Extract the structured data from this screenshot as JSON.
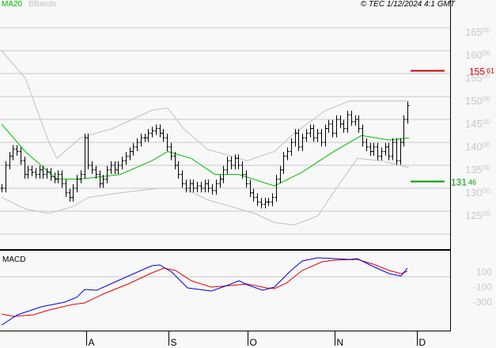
{
  "header": {
    "legend_ma": "MA20",
    "legend_bb": "BBands",
    "copyright": "© TEC 1/12/2024 4:1 GMT"
  },
  "colors": {
    "ma": "#00bb00",
    "bb": "#c0c0c0",
    "macd": "#0000dd",
    "signal": "#dd0000",
    "resistance": "#cc0000",
    "support": "#009900",
    "axis_text": "#c8c8c8"
  },
  "chart_data": [
    {
      "type": "line",
      "title": "Price",
      "ylim": [
        12000,
        16900
      ],
      "y_ticks": [
        12500,
        13000,
        13500,
        14000,
        14500,
        15000,
        15500,
        16000,
        16500
      ],
      "y_tick_labels": [
        "125",
        "130",
        "135",
        "140",
        "145",
        "150",
        "155",
        "160",
        "165"
      ],
      "y_tick_suffix": "00",
      "x_months": [
        {
          "label": "A",
          "day": 22.5
        },
        {
          "label": "S",
          "day": 44.4
        },
        {
          "label": "O",
          "day": 65.5
        },
        {
          "label": "N",
          "day": 88.6
        },
        {
          "label": "D",
          "day": 110.5
        }
      ],
      "close": [
        13000,
        13500,
        13700,
        13850,
        13800,
        13600,
        13300,
        13400,
        13350,
        13300,
        13400,
        13300,
        13350,
        13250,
        13200,
        13300,
        13100,
        12900,
        12800,
        13000,
        13200,
        13300,
        14100,
        13500,
        13400,
        13300,
        13100,
        13200,
        13400,
        13500,
        13400,
        13500,
        13600,
        13700,
        13800,
        13900,
        14000,
        14100,
        14100,
        14200,
        14250,
        14300,
        14200,
        14100,
        13900,
        13700,
        13500,
        13300,
        13100,
        13000,
        13100,
        13000,
        13050,
        13000,
        13100,
        13000,
        12950,
        13100,
        13200,
        13400,
        13600,
        13500,
        13650,
        13500,
        13300,
        13100,
        12900,
        12800,
        12700,
        12650,
        12700,
        12700,
        12800,
        13200,
        13400,
        13700,
        13800,
        14000,
        14200,
        13900,
        14100,
        14200,
        14300,
        14100,
        14200,
        14000,
        14300,
        14400,
        14200,
        14500,
        14400,
        14300,
        14600,
        14450,
        14500,
        14300,
        14000,
        13900,
        13800,
        13900,
        13700,
        13800,
        13900,
        13700,
        14000,
        13600,
        14000,
        14500,
        14800
      ],
      "ma20": [
        [
          0,
          14400
        ],
        [
          6.3,
          13800
        ],
        [
          14.7,
          13200
        ],
        [
          21,
          13200
        ],
        [
          31.6,
          13300
        ],
        [
          40,
          13600
        ],
        [
          44.2,
          13800
        ],
        [
          50.5,
          13650
        ],
        [
          56.8,
          13300
        ],
        [
          63.2,
          13300
        ],
        [
          72.6,
          13050
        ],
        [
          80,
          13350
        ],
        [
          88.4,
          13800
        ],
        [
          95.8,
          14150
        ],
        [
          103.2,
          14050
        ],
        [
          108.4,
          14100
        ]
      ],
      "bb_upper": [
        [
          0,
          16000
        ],
        [
          6.3,
          15400
        ],
        [
          12.6,
          14000
        ],
        [
          14.7,
          13650
        ],
        [
          21,
          14100
        ],
        [
          29.5,
          14300
        ],
        [
          40,
          14700
        ],
        [
          44.2,
          14750
        ],
        [
          48.4,
          14300
        ],
        [
          54.7,
          13850
        ],
        [
          61.1,
          13700
        ],
        [
          65.3,
          13600
        ],
        [
          72.6,
          13800
        ],
        [
          77.9,
          14200
        ],
        [
          86.3,
          14700
        ],
        [
          92.6,
          14900
        ],
        [
          98.9,
          14900
        ],
        [
          108.4,
          14900
        ]
      ],
      "bb_lower": [
        [
          0,
          12800
        ],
        [
          6.3,
          12550
        ],
        [
          12.6,
          12450
        ],
        [
          18.9,
          12600
        ],
        [
          23.2,
          12800
        ],
        [
          31.6,
          12900
        ],
        [
          42.1,
          13000
        ],
        [
          48.4,
          13000
        ],
        [
          54.7,
          12750
        ],
        [
          61.1,
          12600
        ],
        [
          67.4,
          12450
        ],
        [
          72.6,
          12250
        ],
        [
          77.9,
          12200
        ],
        [
          84.2,
          12400
        ],
        [
          89.5,
          13050
        ],
        [
          94.7,
          13650
        ],
        [
          101,
          13600
        ],
        [
          108.4,
          13450
        ]
      ],
      "resistance": {
        "value": 15561,
        "label_main": "155",
        "label_dec": "61"
      },
      "support": {
        "value": 13146,
        "label_main": "131",
        "label_dec": "46"
      }
    },
    {
      "type": "line",
      "title": "MACD",
      "ylim": [
        -650,
        400
      ],
      "y_ticks": [
        100,
        -100,
        -300
      ],
      "y_tick_labels": [
        "100",
        "-100",
        "-300"
      ],
      "macd": [
        [
          0,
          -605
        ],
        [
          4.2,
          -469
        ],
        [
          10.5,
          -363
        ],
        [
          16.8,
          -300
        ],
        [
          20,
          -237
        ],
        [
          22.1,
          -132
        ],
        [
          25.3,
          -142
        ],
        [
          29.5,
          -47
        ],
        [
          34.7,
          68
        ],
        [
          40,
          184
        ],
        [
          42.1,
          195
        ],
        [
          45.3,
          100
        ],
        [
          49.5,
          -111
        ],
        [
          55.8,
          -153
        ],
        [
          60,
          -79
        ],
        [
          63.2,
          -16
        ],
        [
          65.3,
          -68
        ],
        [
          69.5,
          -142
        ],
        [
          72.6,
          -100
        ],
        [
          76.8,
          111
        ],
        [
          80,
          247
        ],
        [
          84.2,
          290
        ],
        [
          92.6,
          268
        ],
        [
          94.7,
          279
        ],
        [
          98.9,
          174
        ],
        [
          103.2,
          79
        ],
        [
          106.3,
          47
        ],
        [
          108,
          153
        ]
      ],
      "signal": [
        [
          0,
          -458
        ],
        [
          3.2,
          -489
        ],
        [
          8.4,
          -469
        ],
        [
          12.6,
          -405
        ],
        [
          18.9,
          -332
        ],
        [
          22.1,
          -311
        ],
        [
          27.4,
          -184
        ],
        [
          33.7,
          -58
        ],
        [
          40,
          89
        ],
        [
          43.2,
          153
        ],
        [
          46.3,
          121
        ],
        [
          50.5,
          -16
        ],
        [
          55.8,
          -100
        ],
        [
          61.1,
          -79
        ],
        [
          65.3,
          -58
        ],
        [
          70.5,
          -111
        ],
        [
          72.6,
          -121
        ],
        [
          75.8,
          -47
        ],
        [
          80,
          121
        ],
        [
          85.3,
          237
        ],
        [
          88.4,
          258
        ],
        [
          94.7,
          268
        ],
        [
          98.9,
          205
        ],
        [
          103.2,
          121
        ],
        [
          106.3,
          79
        ],
        [
          108,
          111
        ]
      ]
    }
  ]
}
